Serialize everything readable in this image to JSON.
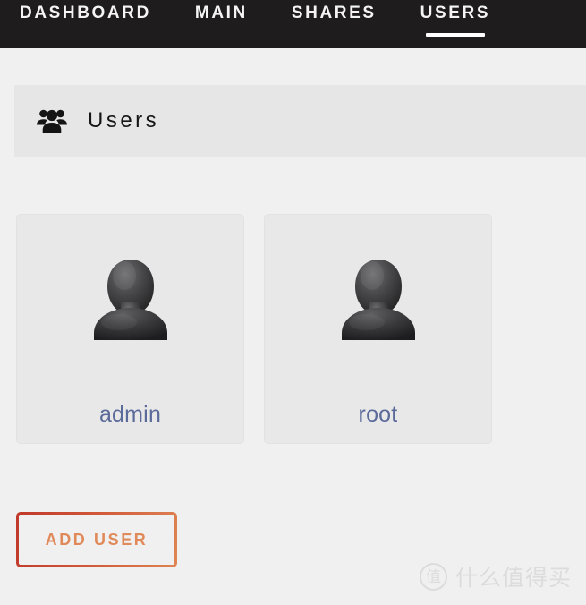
{
  "nav": {
    "items": [
      {
        "label": "DASHBOARD",
        "active": false
      },
      {
        "label": "MAIN",
        "active": false
      },
      {
        "label": "SHARES",
        "active": false
      },
      {
        "label": "USERS",
        "active": true
      }
    ],
    "background_color": "#1e1c1c",
    "text_color": "#f4f4f4",
    "active_indicator_color": "#ffffff"
  },
  "panel": {
    "title": "Users",
    "icon": "users-group-icon",
    "background_color": "#e6e6e6"
  },
  "users": [
    {
      "name": "admin",
      "avatar_icon": "user-avatar-icon"
    },
    {
      "name": "root",
      "avatar_icon": "user-avatar-icon"
    }
  ],
  "add_user_button": {
    "label": "ADD USER",
    "text_color": "#e08a5a",
    "border_gradient_start": "#c0392b",
    "border_gradient_end": "#de8452"
  },
  "watermark": {
    "logo_char": "值",
    "text": "什么值得买",
    "color": "#dcdcdc"
  },
  "theme": {
    "page_background": "#f0f0f0",
    "card_background": "#e8e8e8",
    "username_color": "#5a6a99"
  }
}
